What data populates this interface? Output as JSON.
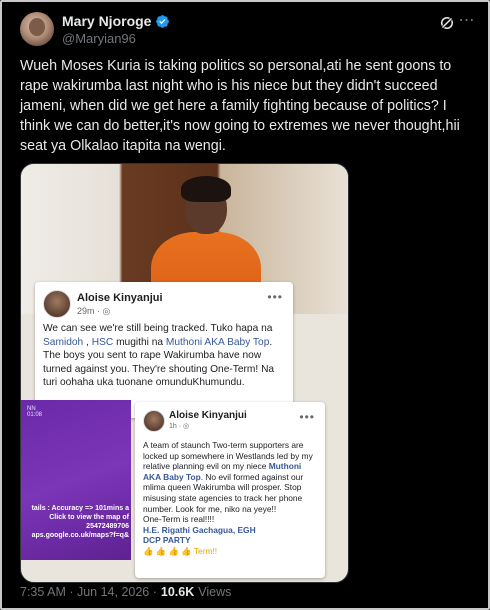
{
  "author": {
    "name": "Mary Njoroge",
    "handle": "@Maryian96",
    "verified": true
  },
  "icons": {
    "verified": "verified-badge-icon",
    "grok": "grok-icon",
    "more": "more-options-icon"
  },
  "colors": {
    "background": "#000000",
    "text": "#e7e9ea",
    "muted": "#71767b",
    "verified": "#1d9bf0",
    "link": "#385898"
  },
  "tweet": {
    "text": "Wueh Moses Kuria is taking politics so personal,ati he sent goons to rape wakirumba last night who is his niece but they didn't succeed jameni, when did we get here a family fighting because of politics? I think we can do better,it's now going to extremes we never thought,hii seat ya Olkalao itapita na wengi."
  },
  "media": {
    "card1": {
      "name": "Aloise Kinyanjui",
      "time": "29m · ",
      "dots": "•••",
      "body_1": "We can see we're still being tracked. Tuko hapa na ",
      "link_1": "Samidoh",
      "body_2": " , ",
      "link_2": "HSC",
      "body_3": " mugithi na ",
      "link_3": "Muthoni AKA Baby Top",
      "body_4": ". The boys you sent to rape Wakirumba have now turned against you. They're shouting One-Term! Na turi oohaha uka tuonane omunduKhumundu."
    },
    "purple_panel": {
      "header": "NN\n01:08",
      "text": "tails : Accuracy => 101mins a\nClick to view the map of\n25472489706\naps.google.co.uk/maps?f=q&"
    },
    "card2": {
      "name": "Aloise Kinyanjui",
      "time": "1h · ",
      "dots": "•••",
      "body_1": "A team of staunch Two-term supporters are locked up somewhere in Westlands led by my relative planning evil on my niece ",
      "link_1": "Muthoni AKA Baby Top",
      "body_2": ". No evil formed against our mlima queen Wakirumba will prosper. Stop misusing state agencies to track her phone number. Look for me, niko na yeye!!",
      "line_1": "One-Term is real!!!!",
      "line_2": "H.E. Rigathi Gachagua, EGH",
      "line_3": "DCP PARTY",
      "line_4": "👍 👍 👍 👍 Term!!"
    }
  },
  "footer": {
    "time": "7:35 AM · Jun 14, 2026 · ",
    "views_count": "10.6K",
    "views_label": "Views"
  }
}
